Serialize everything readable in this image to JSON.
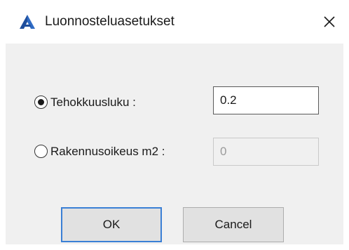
{
  "window": {
    "title": "Luonnosteluasetukset",
    "app_icon": "autocad-a-icon",
    "close_glyph": "✕"
  },
  "form": {
    "options": [
      {
        "label": "Tehokkuusluku :",
        "selected": true,
        "value": "0.2",
        "enabled": true
      },
      {
        "label": "Rakennusoikeus m2 :",
        "selected": false,
        "value": "0",
        "enabled": false
      }
    ]
  },
  "buttons": {
    "ok_label": "OK",
    "cancel_label": "Cancel"
  },
  "colors": {
    "accent": "#3a7fd5",
    "icon_blue": "#1f4e9c",
    "panel": "#f0f0f0"
  }
}
